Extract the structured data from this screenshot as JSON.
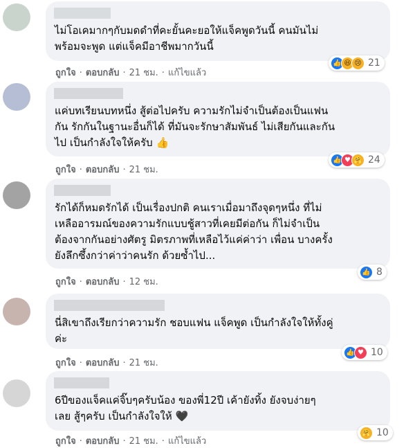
{
  "labels": {
    "like": "ถูกใจ",
    "reply": "ตอบกลับ",
    "edited": "แก้ไขแล้ว",
    "sep": "·"
  },
  "comments": [
    {
      "text": "ไม่โอเคมากๆกับมดดำที่คะยั้นคะยอให้แจ็คพูดวันนี้ คนมันไม่\nพร้อมจะพูด แต่แจ็คมีอาชีพมากวันนี้",
      "reactions": [
        "like-icon",
        "haha-icon",
        "sad-icon"
      ],
      "reaction_count": "21",
      "time": "21 ชม.",
      "edited": true
    },
    {
      "text": "แค่บทเรียนบทหนึ่ง สู้ต่อไปครับ ความรักไม่จำเป็นต้องเป็นแฟน\nกัน รักกันในฐานะอื่นก็ได้ ที่มันจะรักษาสัมพันธ์ ไม่เสียกันและกัน\nไป เป็นกำลังใจให้ครับ 👍",
      "reactions": [
        "like-icon",
        "love-icon",
        "care-icon"
      ],
      "reaction_count": "24",
      "time": "21 ชม.",
      "edited": false
    },
    {
      "text": "รักได้ก็หมดรักได้ เป็นเรื่องปกติ คนเราเมื่อมาถึงจุดๆหนึ่ง ที่ไม่\nเหลืออารมณ์ของความรักแบบชู้สาวที่เคยมีต่อกัน ก็ไม่จำเป็น\nต้องจากกันอย่างศัตรู มิตรภาพที่เหลือไว้แค่ค่าว่า เพื่อน บางครั้ง\nยังลึกซึ้งกว่าค่าว่าคนรัก ด้วยซ้ำไป...",
      "reactions": [
        "like-icon"
      ],
      "reaction_count": "8",
      "time": "12 ชม.",
      "edited": false
    },
    {
      "text": "นี่สิเขาถึงเรียกว่าความรัก ชอบแฟน แจ็คพูด เป็นกำลังใจให้ทั้งคู่\nค่ะ",
      "reactions": [
        "like-icon",
        "love-icon"
      ],
      "reaction_count": "10",
      "time": "21 ชม.",
      "edited": false
    },
    {
      "text": "6ปีของแจ็คแค่จิ๊บๆครับน้อง ของพี่12ปี เค้ายังทิ้ง ยังจบง่ายๆ\nเลย สู้ๆครับ เป็นกำลังใจให้ 🖤",
      "reactions": [
        "care-icon"
      ],
      "reaction_count": "10",
      "time": "21 ชม.",
      "edited": true
    }
  ],
  "colors": {
    "bubble": "#f0f2f5",
    "like": "#1877f2",
    "love": "#f33e58",
    "yellow": "#f7b125",
    "meta": "#65676b"
  }
}
